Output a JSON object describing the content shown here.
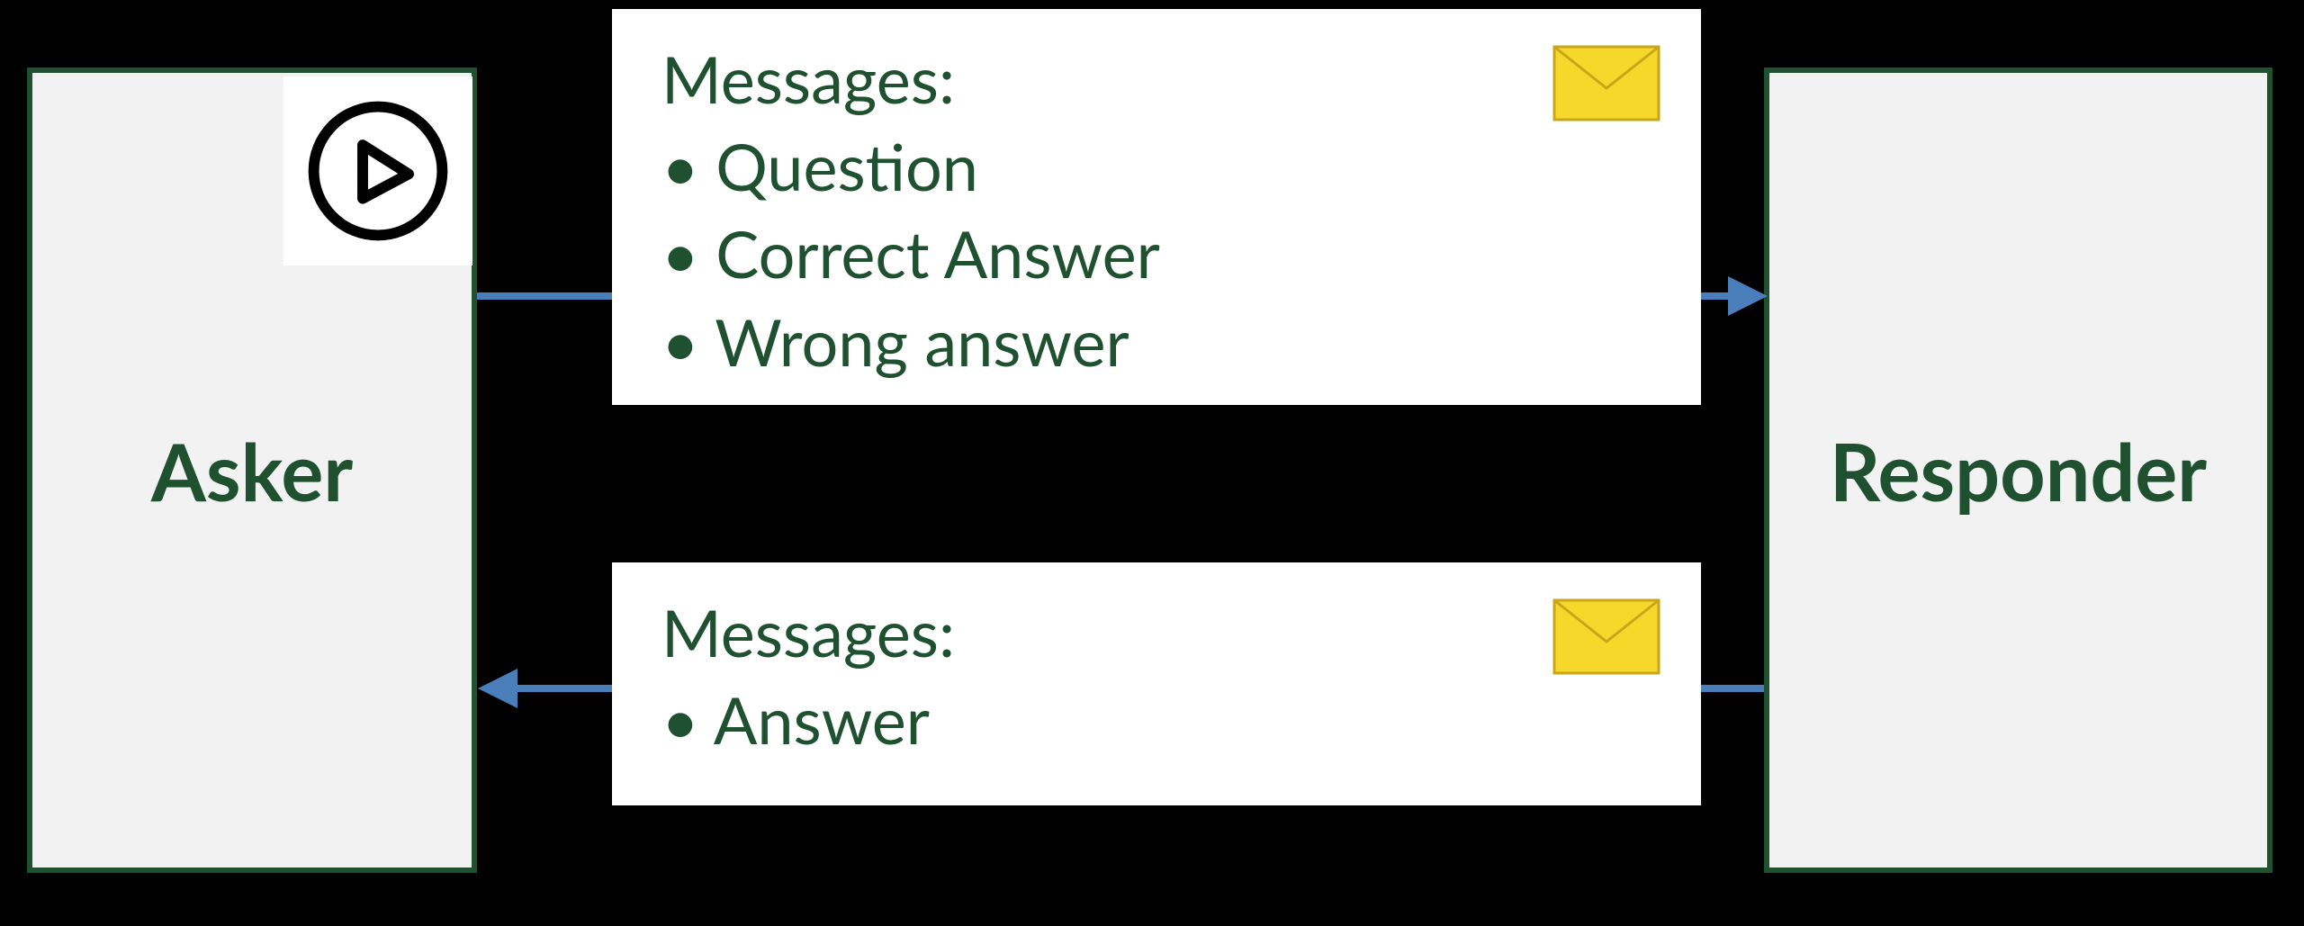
{
  "actors": {
    "asker": {
      "label": "Asker"
    },
    "responder": {
      "label": "Responder"
    }
  },
  "boxes": {
    "top": {
      "title": "Messages:",
      "items": [
        "Question",
        "Correct Answer",
        "Wrong answer"
      ]
    },
    "bottom": {
      "title": "Messages:",
      "items": [
        "Answer"
      ]
    }
  },
  "icons": {
    "play": "play-icon",
    "mail": "mail-icon"
  },
  "colors": {
    "border": "#1f5131",
    "text": "#1f5131",
    "arrow": "#4a7ebb",
    "boxFill": "#f2f2f2",
    "mailFill": "#f6d82b",
    "mailStroke": "#c9a51a"
  }
}
